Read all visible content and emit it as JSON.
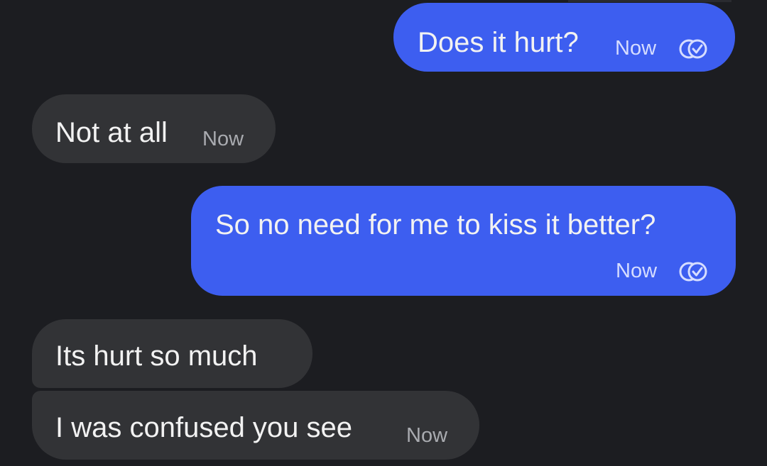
{
  "messages": [
    {
      "direction": "outgoing",
      "text": "Does it hurt?",
      "time": "Now",
      "status_icon": "read-receipt-icon"
    },
    {
      "direction": "incoming",
      "text": "Not at all",
      "time": "Now"
    },
    {
      "direction": "outgoing",
      "text": "So no need for me to kiss it better?",
      "time": "Now",
      "status_icon": "read-receipt-icon"
    },
    {
      "direction": "incoming",
      "text": "Its hurt so much"
    },
    {
      "direction": "incoming",
      "text": "I was confused you see",
      "time": "Now"
    }
  ],
  "colors": {
    "background": "#1c1d21",
    "outgoing_bubble": "#3d5ef0",
    "incoming_bubble": "#323336"
  }
}
